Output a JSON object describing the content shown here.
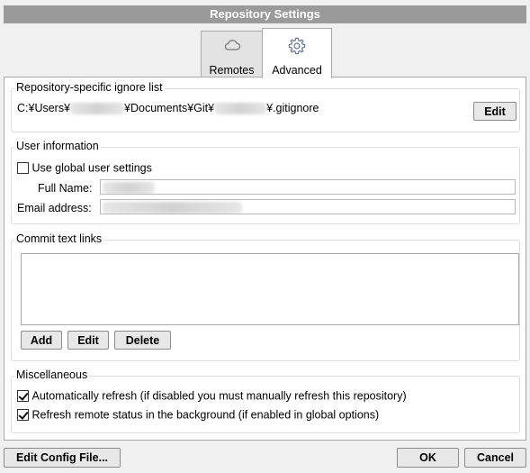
{
  "window": {
    "title": "Repository Settings"
  },
  "tabs": [
    {
      "label": "Remotes",
      "icon": "cloud-icon"
    },
    {
      "label": "Advanced",
      "icon": "gear-icon"
    }
  ],
  "ignore": {
    "title": "Repository-specific ignore list",
    "path_prefix": "C:¥Users¥",
    "path_mid": "¥Documents¥Git¥",
    "path_suffix": "¥.gitignore",
    "edit_label": "Edit"
  },
  "user": {
    "title": "User information",
    "use_global_label": "Use global user settings",
    "use_global_checked": false,
    "full_name_label": "Full Name:",
    "email_label": "Email address:"
  },
  "links": {
    "title": "Commit text links",
    "add_label": "Add",
    "edit_label": "Edit",
    "delete_label": "Delete"
  },
  "misc": {
    "title": "Miscellaneous",
    "auto_refresh_label": "Automatically refresh (if disabled you must manually refresh this repository)",
    "auto_refresh_checked": true,
    "remote_status_label": "Refresh remote status in the background (if enabled in global options)",
    "remote_status_checked": true
  },
  "footer": {
    "edit_config_label": "Edit Config File...",
    "ok_label": "OK",
    "cancel_label": "Cancel"
  }
}
